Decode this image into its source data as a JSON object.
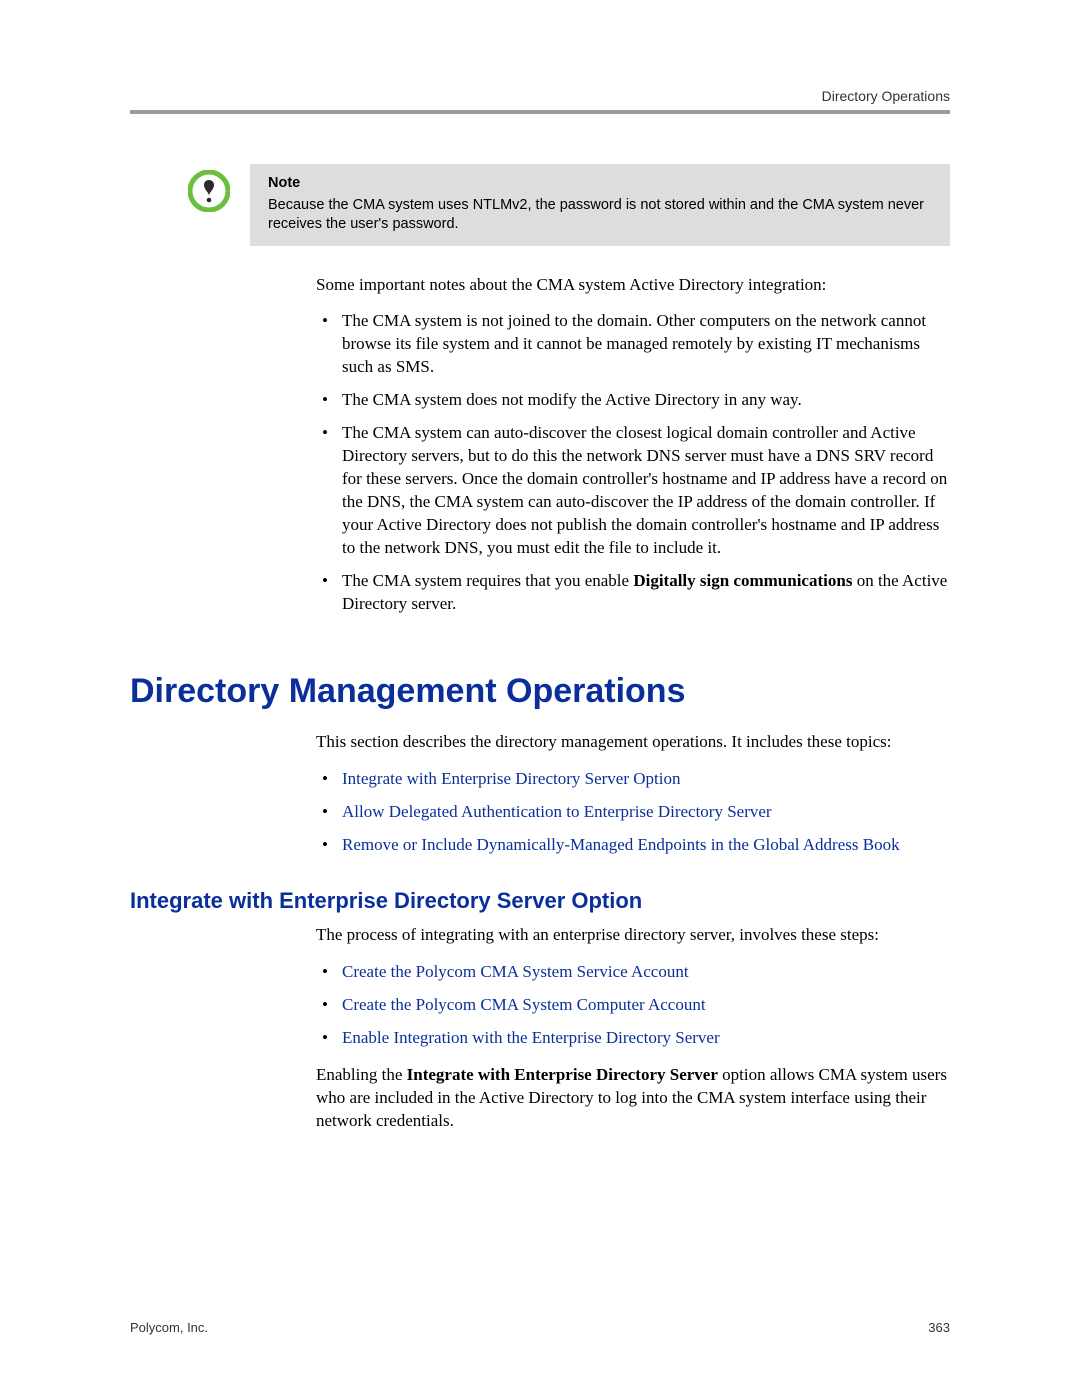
{
  "header": {
    "running_title": "Directory Operations"
  },
  "note": {
    "title": "Note",
    "body": "Because the CMA system uses NTLMv2, the password is not stored within and the CMA system never receives the user's password."
  },
  "intro_para": "Some important notes about the CMA system Active Directory integration:",
  "notes_list": [
    "The CMA system is not joined to the domain. Other computers on the network cannot browse its file system and it cannot be managed remotely by existing IT mechanisms such as SMS.",
    "The CMA system does not modify the Active Directory in any way.",
    "The CMA system can auto-discover the closest logical domain controller and Active Directory servers, but to do this the network DNS server must have a DNS SRV record for these servers. Once the domain controller's hostname and IP address have a record on the DNS, the CMA system can auto-discover the IP address of the domain controller. If your Active Directory does not publish the domain controller's hostname and IP address to the network DNS, you must edit the file to include it."
  ],
  "notes_item4": {
    "pre": "The CMA system requires that you enable ",
    "bold": "Digitally sign communications",
    "post": " on the Active Directory server."
  },
  "section_title": "Directory Management Operations",
  "section_intro": "This section describes the directory management operations. It includes these topics:",
  "section_links": [
    "Integrate with Enterprise Directory Server Option",
    "Allow Delegated Authentication to Enterprise Directory Server",
    "Remove or Include Dynamically-Managed Endpoints in the Global Address Book"
  ],
  "subsection_title": "Integrate with Enterprise Directory Server Option",
  "subsection_intro": "The process of integrating with an enterprise directory server, involves these steps:",
  "subsection_links": [
    "Create the Polycom CMA System Service Account",
    "Create the Polycom CMA System Computer Account",
    "Enable Integration with the Enterprise Directory Server"
  ],
  "closing_para": {
    "pre": "Enabling the ",
    "bold": "Integrate with Enterprise Directory Server",
    "post": " option allows CMA system users who are included in the Active Directory to log into the CMA system interface using their network credentials."
  },
  "footer": {
    "left": "Polycom, Inc.",
    "right": "363"
  }
}
